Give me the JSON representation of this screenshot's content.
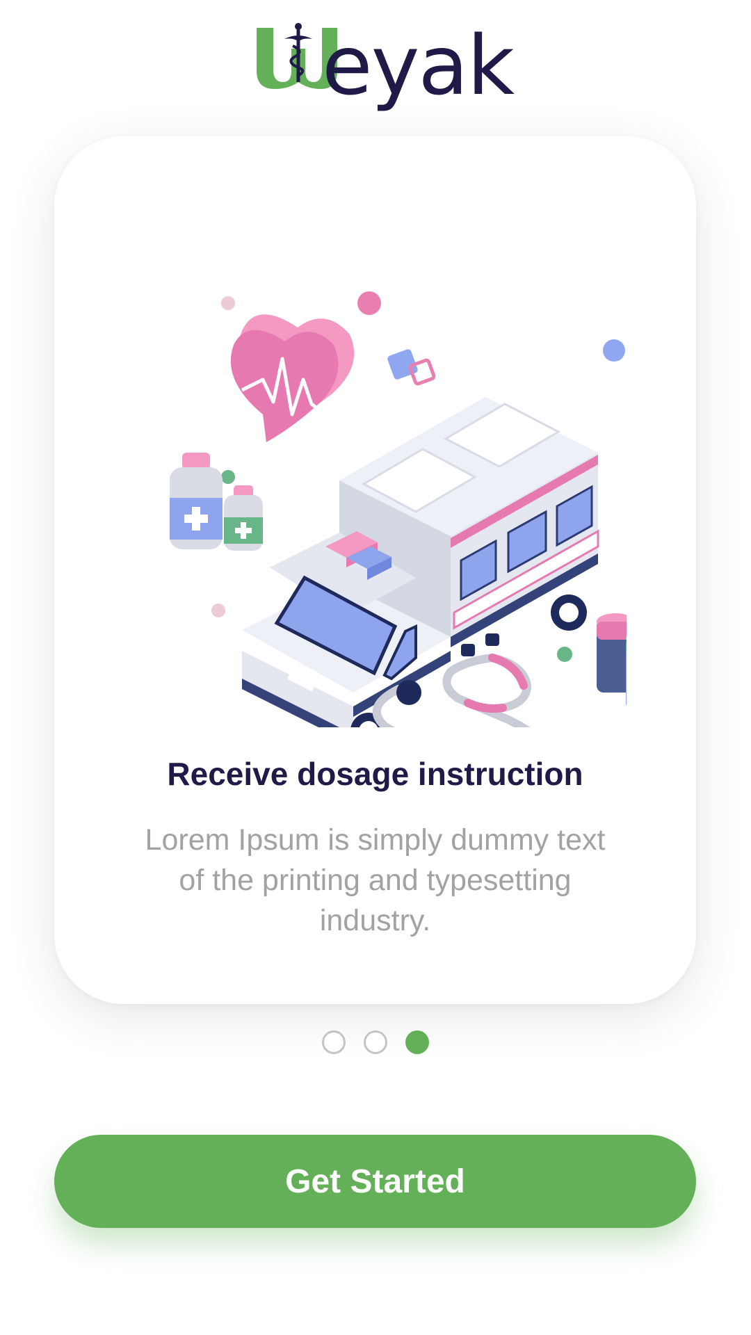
{
  "logo": {
    "text": "eyak",
    "initial": "W",
    "brand_colors": {
      "green": "#64b058",
      "navy": "#1f1a47"
    }
  },
  "slide": {
    "title": "Receive dosage instruction",
    "description": "Lorem Ipsum is simply dummy text of the printing and typesetting industry."
  },
  "pager": {
    "total": 3,
    "active_index": 3
  },
  "cta": {
    "label": "Get Started",
    "color": "#64b058"
  },
  "icons": [
    "heart-pulse-icon",
    "ambulance-icon",
    "stethoscope-icon",
    "medicine-bottle-icon",
    "pill-jar-icon"
  ]
}
